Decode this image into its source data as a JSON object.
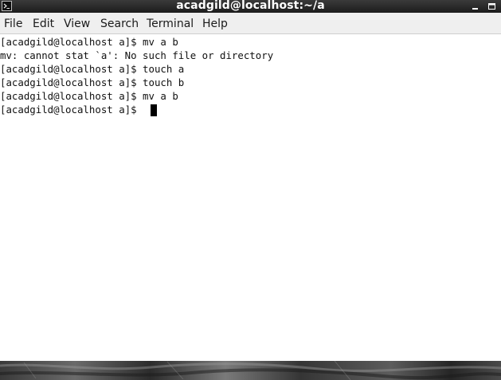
{
  "window": {
    "title": "acadgild@localhost:~/a"
  },
  "menu": {
    "items": [
      "File",
      "Edit",
      "View",
      "Search",
      "Terminal",
      "Help"
    ]
  },
  "terminal": {
    "lines": [
      "[acadgild@localhost a]$ mv a b",
      "mv: cannot stat `a': No such file or directory",
      "[acadgild@localhost a]$ touch a",
      "[acadgild@localhost a]$ touch b",
      "[acadgild@localhost a]$ mv a b",
      "[acadgild@localhost a]$ "
    ]
  },
  "colors": {
    "titlebar": "#2a2a2a",
    "menubar": "#efefef",
    "terminal_bg": "#ffffff",
    "terminal_fg": "#111111"
  },
  "icons": {
    "app": "terminal-icon",
    "minimize": "minimize-icon",
    "maximize": "maximize-icon"
  }
}
